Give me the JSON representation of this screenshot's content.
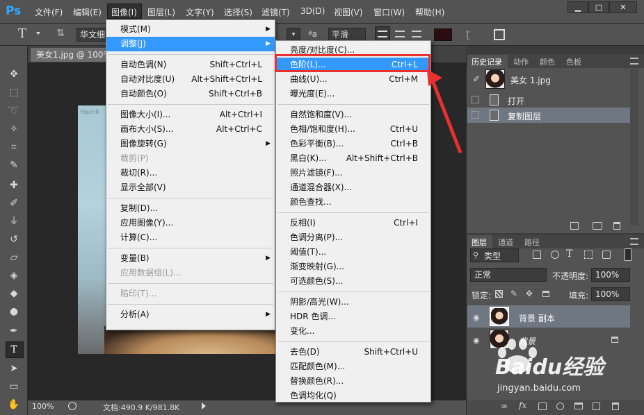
{
  "app": {
    "logo": "Ps"
  },
  "menubar": [
    "文件(F)",
    "编辑(E)",
    "图像(I)",
    "图层(L)",
    "文字(Y)",
    "选择(S)",
    "滤镜(T)",
    "3D(D)",
    "视图(V)",
    "窗口(W)",
    "帮助(H)"
  ],
  "window_controls": [
    "▁",
    "□",
    "✕"
  ],
  "options": {
    "tool_glyph": "T",
    "font_family": "华文细",
    "antialias": "平滑",
    "aa_glyph": "ªa"
  },
  "document_tab": "美女1.jpg @ 100%",
  "canvas_watermark": "FlechR",
  "status": {
    "zoom": "100%",
    "doc": "文档:490.9 K/981.8K"
  },
  "history_panel": {
    "tabs": [
      "历史记录",
      "动作",
      "颜色",
      "色板"
    ],
    "snapshot": "美女 1.jpg",
    "steps": [
      "打开",
      "复制图层"
    ]
  },
  "layers_panel": {
    "tabs": [
      "图层",
      "通道",
      "路径"
    ],
    "filter_label": "类型",
    "blend_mode": "正常",
    "opacity_label": "不透明度:",
    "opacity": "100%",
    "lock_label": "锁定:",
    "fill_label": "填充:",
    "fill": "100%",
    "layers": [
      "背景 副本",
      "背景"
    ]
  },
  "image_menu": {
    "items": [
      {
        "label": "模式(M)",
        "shortcut": "",
        "submenu": true
      },
      {
        "label": "调整(J)",
        "shortcut": "",
        "submenu": true,
        "highlighted": true
      },
      {
        "sep": true
      },
      {
        "label": "自动色调(N)",
        "shortcut": "Shift+Ctrl+L"
      },
      {
        "label": "自动对比度(U)",
        "shortcut": "Alt+Shift+Ctrl+L"
      },
      {
        "label": "自动颜色(O)",
        "shortcut": "Shift+Ctrl+B"
      },
      {
        "sep": true
      },
      {
        "label": "图像大小(I)...",
        "shortcut": "Alt+Ctrl+I"
      },
      {
        "label": "画布大小(S)...",
        "shortcut": "Alt+Ctrl+C"
      },
      {
        "label": "图像旋转(G)",
        "shortcut": "",
        "submenu": true
      },
      {
        "label": "裁剪(P)",
        "shortcut": "",
        "disabled": true
      },
      {
        "label": "裁切(R)...",
        "shortcut": ""
      },
      {
        "label": "显示全部(V)",
        "shortcut": ""
      },
      {
        "sep": true
      },
      {
        "label": "复制(D)...",
        "shortcut": ""
      },
      {
        "label": "应用图像(Y)...",
        "shortcut": ""
      },
      {
        "label": "计算(C)...",
        "shortcut": ""
      },
      {
        "sep": true
      },
      {
        "label": "变量(B)",
        "shortcut": "",
        "submenu": true
      },
      {
        "label": "应用数据组(L)...",
        "shortcut": "",
        "disabled": true
      },
      {
        "sep": true
      },
      {
        "label": "陷印(T)...",
        "shortcut": "",
        "disabled": true
      },
      {
        "sep": true
      },
      {
        "label": "分析(A)",
        "shortcut": "",
        "submenu": true
      }
    ]
  },
  "adjust_menu": {
    "items": [
      {
        "label": "亮度/对比度(C)...",
        "shortcut": ""
      },
      {
        "label": "色阶(L)...",
        "shortcut": "Ctrl+L",
        "highlighted": true
      },
      {
        "label": "曲线(U)...",
        "shortcut": "Ctrl+M"
      },
      {
        "label": "曝光度(E)...",
        "shortcut": ""
      },
      {
        "sep": true
      },
      {
        "label": "自然饱和度(V)...",
        "shortcut": ""
      },
      {
        "label": "色相/饱和度(H)...",
        "shortcut": "Ctrl+U"
      },
      {
        "label": "色彩平衡(B)...",
        "shortcut": "Ctrl+B"
      },
      {
        "label": "黑白(K)...",
        "shortcut": "Alt+Shift+Ctrl+B"
      },
      {
        "label": "照片滤镜(F)...",
        "shortcut": ""
      },
      {
        "label": "通道混合器(X)...",
        "shortcut": ""
      },
      {
        "label": "颜色查找...",
        "shortcut": ""
      },
      {
        "sep": true
      },
      {
        "label": "反相(I)",
        "shortcut": "Ctrl+I"
      },
      {
        "label": "色调分离(P)...",
        "shortcut": ""
      },
      {
        "label": "阈值(T)...",
        "shortcut": ""
      },
      {
        "label": "渐变映射(G)...",
        "shortcut": ""
      },
      {
        "label": "可选颜色(S)...",
        "shortcut": ""
      },
      {
        "sep": true
      },
      {
        "label": "阴影/高光(W)...",
        "shortcut": ""
      },
      {
        "label": "HDR 色调...",
        "shortcut": ""
      },
      {
        "label": "变化...",
        "shortcut": ""
      },
      {
        "sep": true
      },
      {
        "label": "去色(D)",
        "shortcut": "Shift+Ctrl+U"
      },
      {
        "label": "匹配颜色(M)...",
        "shortcut": ""
      },
      {
        "label": "替换颜色(R)...",
        "shortcut": ""
      },
      {
        "label": "色调均化(Q)",
        "shortcut": ""
      }
    ]
  },
  "watermark": {
    "brand": "Baidu经验",
    "url": "jingyan.baidu.com"
  },
  "colors": {
    "highlight": "#3399ff",
    "annotation": "#e8312f",
    "ps_blue": "#31a8ff"
  }
}
